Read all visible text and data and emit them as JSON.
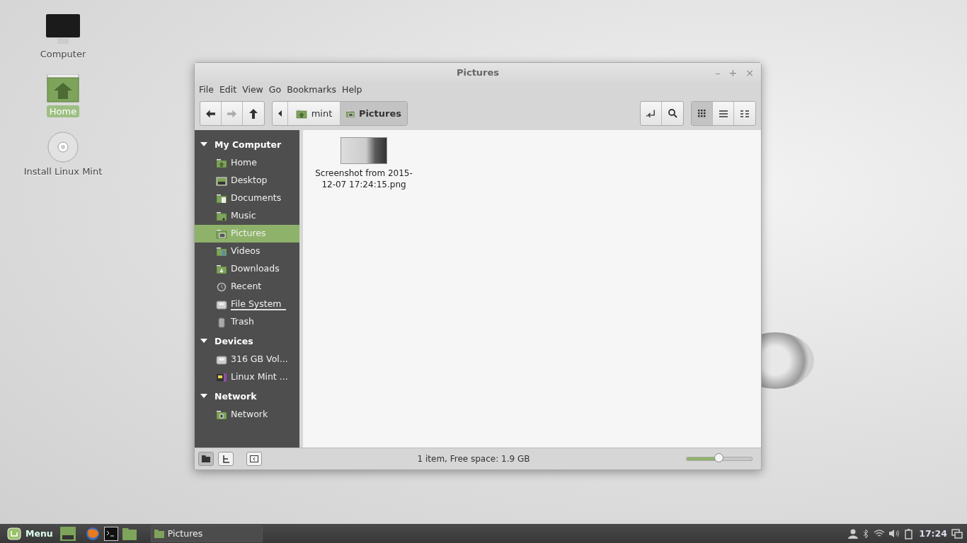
{
  "desktop_icons": [
    {
      "label": "Computer",
      "kind": "monitor",
      "selected": false
    },
    {
      "label": "Home",
      "kind": "home",
      "selected": true
    },
    {
      "label": "Install Linux Mint",
      "kind": "disc",
      "selected": false
    }
  ],
  "window": {
    "title": "Pictures",
    "controls": [
      "–",
      "+",
      "×"
    ],
    "menu": [
      "File",
      "Edit",
      "View",
      "Go",
      "Bookmarks",
      "Help"
    ],
    "nav_buttons": [
      {
        "kind": "back",
        "disabled": false
      },
      {
        "kind": "forward",
        "disabled": true
      },
      {
        "kind": "up",
        "disabled": false
      }
    ],
    "breadcrumb": [
      {
        "label": "mint",
        "kind": "home",
        "selected": false
      },
      {
        "label": "Pictures",
        "kind": "pictures",
        "selected": true
      }
    ],
    "view_buttons": [
      {
        "kind": "icons",
        "selected": true
      },
      {
        "kind": "list",
        "selected": false
      },
      {
        "kind": "compact",
        "selected": false
      }
    ],
    "sidebar": [
      {
        "title": "My Computer",
        "expanded": true,
        "items": [
          {
            "label": "Home",
            "kind": "home",
            "selected": false,
            "focused": false
          },
          {
            "label": "Desktop",
            "kind": "desktop",
            "selected": false,
            "focused": false
          },
          {
            "label": "Documents",
            "kind": "documents",
            "selected": false,
            "focused": false
          },
          {
            "label": "Music",
            "kind": "music",
            "selected": false,
            "focused": false
          },
          {
            "label": "Pictures",
            "kind": "pictures",
            "selected": true,
            "focused": false
          },
          {
            "label": "Videos",
            "kind": "videos",
            "selected": false,
            "focused": false
          },
          {
            "label": "Downloads",
            "kind": "downloads",
            "selected": false,
            "focused": false
          },
          {
            "label": "Recent",
            "kind": "recent",
            "selected": false,
            "focused": false
          },
          {
            "label": "File System",
            "kind": "drive",
            "selected": false,
            "focused": true
          },
          {
            "label": "Trash",
            "kind": "trash",
            "selected": false,
            "focused": false
          }
        ]
      },
      {
        "title": "Devices",
        "expanded": true,
        "items": [
          {
            "label": "316 GB Vol...",
            "kind": "drive",
            "selected": false,
            "focused": false
          },
          {
            "label": "Linux Mint ...",
            "kind": "media",
            "selected": false,
            "focused": false
          }
        ]
      },
      {
        "title": "Network",
        "expanded": true,
        "items": [
          {
            "label": "Network",
            "kind": "network",
            "selected": false,
            "focused": false
          }
        ]
      }
    ],
    "files": [
      {
        "name": "Screenshot from 2015-12-07 17:24:15.png"
      }
    ],
    "status": "1 item, Free space: 1.9 GB",
    "side_pane_buttons": [
      {
        "kind": "places",
        "selected": true
      },
      {
        "kind": "tree",
        "selected": false
      }
    ],
    "zoom": {
      "level": 0.5
    }
  },
  "taskbar": {
    "menu_label": "Menu",
    "launchers": [
      {
        "kind": "files-green"
      },
      {
        "kind": "firefox"
      },
      {
        "kind": "terminal"
      },
      {
        "kind": "folder"
      }
    ],
    "tasks": [
      {
        "label": "Pictures",
        "selected": false
      }
    ],
    "clock": "17:24"
  }
}
